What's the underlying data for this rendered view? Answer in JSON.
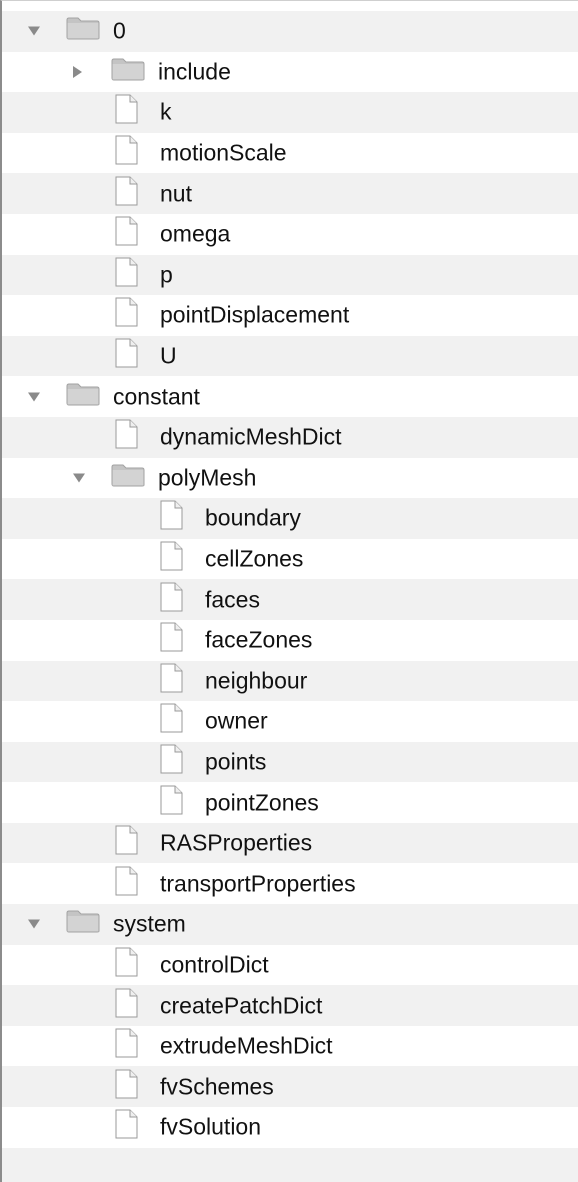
{
  "file_browser": {
    "items": [
      {
        "label": "0",
        "type": "folder",
        "depth": 0,
        "state": "expanded"
      },
      {
        "label": "include",
        "type": "folder",
        "depth": 1,
        "state": "collapsed"
      },
      {
        "label": "k",
        "type": "file",
        "depth": 1
      },
      {
        "label": "motionScale",
        "type": "file",
        "depth": 1
      },
      {
        "label": "nut",
        "type": "file",
        "depth": 1
      },
      {
        "label": "omega",
        "type": "file",
        "depth": 1
      },
      {
        "label": "p",
        "type": "file",
        "depth": 1
      },
      {
        "label": "pointDisplacement",
        "type": "file",
        "depth": 1
      },
      {
        "label": "U",
        "type": "file",
        "depth": 1
      },
      {
        "label": "constant",
        "type": "folder",
        "depth": 0,
        "state": "expanded"
      },
      {
        "label": "dynamicMeshDict",
        "type": "file",
        "depth": 1
      },
      {
        "label": "polyMesh",
        "type": "folder",
        "depth": 1,
        "state": "expanded"
      },
      {
        "label": "boundary",
        "type": "file",
        "depth": 2
      },
      {
        "label": "cellZones",
        "type": "file",
        "depth": 2
      },
      {
        "label": "faces",
        "type": "file",
        "depth": 2
      },
      {
        "label": "faceZones",
        "type": "file",
        "depth": 2
      },
      {
        "label": "neighbour",
        "type": "file",
        "depth": 2
      },
      {
        "label": "owner",
        "type": "file",
        "depth": 2
      },
      {
        "label": "points",
        "type": "file",
        "depth": 2
      },
      {
        "label": "pointZones",
        "type": "file",
        "depth": 2
      },
      {
        "label": "RASProperties",
        "type": "file",
        "depth": 1
      },
      {
        "label": "transportProperties",
        "type": "file",
        "depth": 1
      },
      {
        "label": "system",
        "type": "folder",
        "depth": 0,
        "state": "expanded"
      },
      {
        "label": "controlDict",
        "type": "file",
        "depth": 1
      },
      {
        "label": "createPatchDict",
        "type": "file",
        "depth": 1
      },
      {
        "label": "extrudeMeshDict",
        "type": "file",
        "depth": 1
      },
      {
        "label": "fvSchemes",
        "type": "file",
        "depth": 1
      },
      {
        "label": "fvSolution",
        "type": "file",
        "depth": 1
      }
    ]
  },
  "colors": {
    "row_alt": "#f1f1f1",
    "row_base": "#ffffff",
    "text": "#111111",
    "folder": "#c4c4c4",
    "disclosure": "#8a8a8a"
  }
}
